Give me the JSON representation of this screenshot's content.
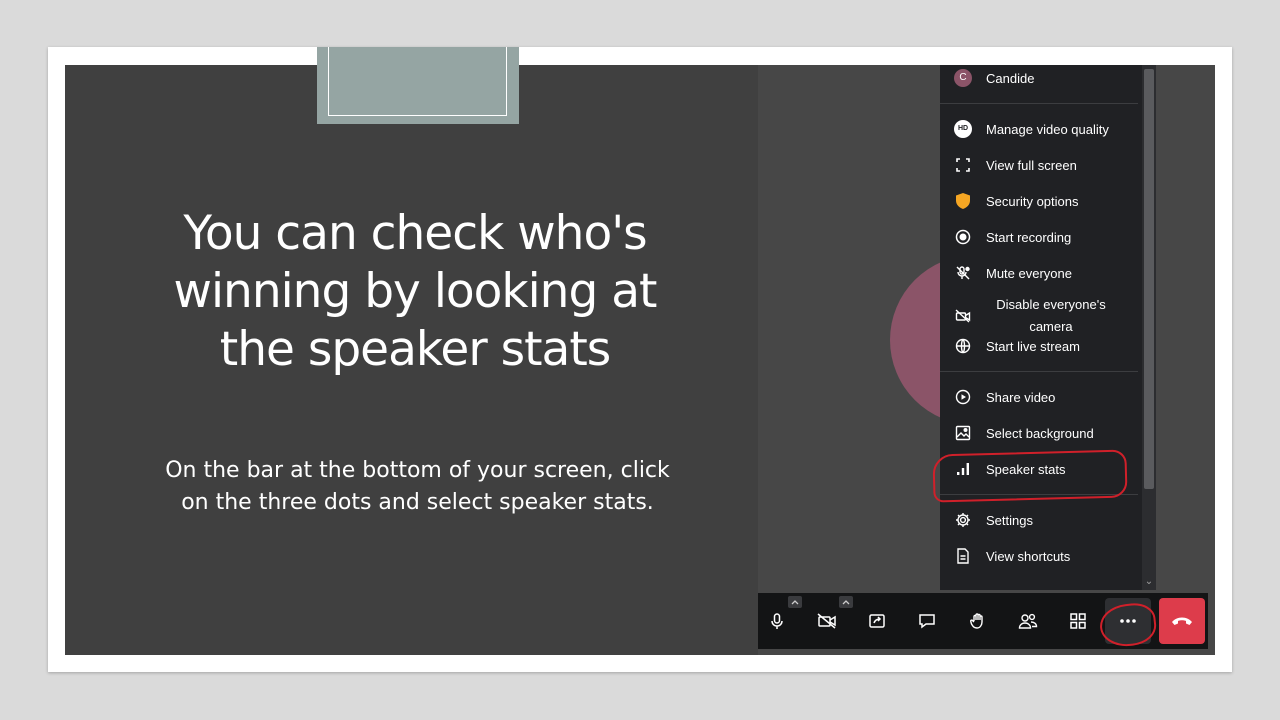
{
  "slide": {
    "title": "You can check who's winning by looking at the speaker stats",
    "body": "On the bar at the bottom of your screen, click on the three dots and select speaker stats."
  },
  "menu": {
    "user": {
      "initial": "C",
      "name": "Candide"
    },
    "items": [
      {
        "label": "Manage video quality",
        "icon": "hd-icon"
      },
      {
        "label": "View full screen",
        "icon": "fullscreen-icon"
      },
      {
        "label": "Security options",
        "icon": "shield-icon"
      },
      {
        "label": "Start recording",
        "icon": "record-icon"
      },
      {
        "label": "Mute everyone",
        "icon": "mute-all-icon"
      },
      {
        "label": "Disable everyone's camera",
        "icon": "camera-off-icon"
      },
      {
        "label": "Start live stream",
        "icon": "live-stream-icon"
      },
      {
        "label": "Share video",
        "icon": "play-icon"
      },
      {
        "label": "Select background",
        "icon": "background-icon"
      },
      {
        "label": "Speaker stats",
        "icon": "bar-chart-icon"
      },
      {
        "label": "Settings",
        "icon": "gear-icon"
      },
      {
        "label": "View shortcuts",
        "icon": "document-icon"
      }
    ]
  },
  "toolbar": {
    "buttons": [
      "microphone-icon",
      "camera-off-icon",
      "screen-share-icon",
      "chat-icon",
      "raise-hand-icon",
      "participants-icon",
      "tile-view-icon",
      "more-options-icon",
      "hang-up-icon"
    ]
  },
  "colors": {
    "slide_bg": "#404040",
    "accent_tab": "#95a5a3",
    "menu_bg": "#202124",
    "avatar": "#8b5468",
    "hangup": "#dd3c4b",
    "annotation": "#d0202a",
    "security_shield": "#f5a623"
  }
}
